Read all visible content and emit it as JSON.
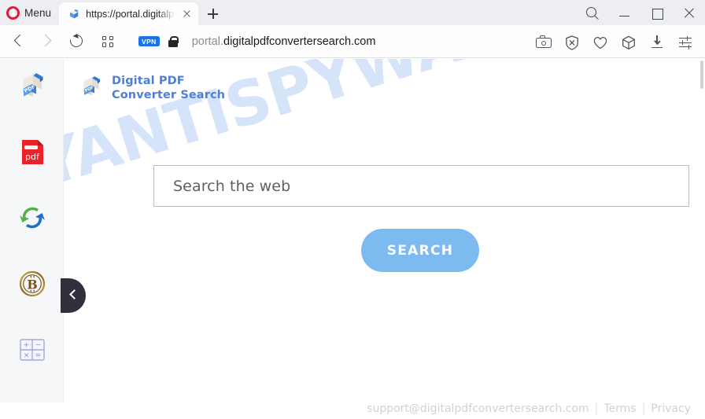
{
  "browser": {
    "name": "Opera",
    "menu_label": "Menu",
    "tab": {
      "title": "https://portal.digitalp",
      "favicon": "pdf-document-icon",
      "close_icon": "close-icon"
    },
    "new_tab_icon": "plus-icon",
    "window_controls": [
      {
        "name": "search-button",
        "icon": "search-icon"
      },
      {
        "name": "minimize-button",
        "icon": "minimize-icon"
      },
      {
        "name": "maximize-button",
        "icon": "maximize-icon"
      },
      {
        "name": "close-window-button",
        "icon": "close-icon"
      }
    ],
    "nav": {
      "back_icon": "back-arrow-icon",
      "forward_icon": "forward-arrow-icon",
      "reload_icon": "reload-icon",
      "speeddial_icon": "grid-icon",
      "vpn_badge": "VPN",
      "lock_icon": "lock-icon",
      "url_prefix": "portal.",
      "url_domain": "digitalpdfconvertersearch.com"
    },
    "toolbar_icons": [
      {
        "name": "snapshot-button",
        "icon": "camera-icon"
      },
      {
        "name": "ad-blocker-button",
        "icon": "shield-x-icon"
      },
      {
        "name": "favorites-button",
        "icon": "heart-icon"
      },
      {
        "name": "player-button",
        "icon": "cube-icon"
      },
      {
        "name": "downloads-button",
        "icon": "download-icon"
      },
      {
        "name": "easy-setup-button",
        "icon": "sliders-icon"
      }
    ]
  },
  "page": {
    "watermark": "MYANTISPYWARE.COM",
    "brand": {
      "logo_icon": "pdf-document-3d-icon",
      "line1": "Digital PDF",
      "line2": "Converter Search",
      "color": "#4f7fd6"
    },
    "sidebar": {
      "items": [
        {
          "name": "sidebar-item-pdf-converter",
          "icon": "pdf-document-3d-icon"
        },
        {
          "name": "sidebar-item-pdf-file",
          "icon": "pdf-file-red-icon"
        },
        {
          "name": "sidebar-item-file-convert",
          "icon": "convert-arrows-icon"
        },
        {
          "name": "sidebar-item-bitcoin",
          "icon": "bitcoin-icon"
        },
        {
          "name": "sidebar-item-calculator",
          "icon": "calculator-icon"
        }
      ],
      "collapse_icon": "chevron-left-icon"
    },
    "search": {
      "placeholder": "Search the web",
      "value": "",
      "button_label": "SEARCH",
      "button_color": "#7cbaf0"
    },
    "footer": {
      "email": "support@digitalpdfconvertersearch.com",
      "separator": "|",
      "terms": "Terms",
      "privacy": "Privacy"
    }
  }
}
